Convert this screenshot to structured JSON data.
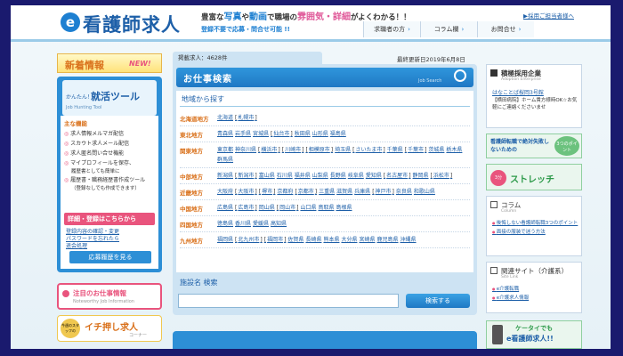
{
  "header": {
    "logo_mark": "e",
    "logo_text": "看護師求人",
    "tagline_pre": "豊富な",
    "tagline_hl1": "写真",
    "tagline_mid": "や",
    "tagline_hl2": "動画",
    "tagline_mid2": "で職場の",
    "tagline_hl3": "雰囲気・詳細",
    "tagline_post": "がよくわかる！！",
    "sub_tag": "登録不要で応募・問合せ可能 !!",
    "recruit_link": "▶採用ご担当者様へ",
    "nav": [
      "求職者の方",
      "コラム欄",
      "お問合せ"
    ]
  },
  "left": {
    "new_banner_t1": "新着情報",
    "new_banner_t2": "NEW!",
    "tool_small": "かんたん！",
    "tool_big": "就活ツール",
    "tool_en": "Job Hunting Tool",
    "main_func": "主な機能",
    "functions": [
      "求人情報メルマガ配信",
      "スカウト求人メール配信",
      "求人匿名問い合せ機能",
      "マイプロフィールを保存、"
    ],
    "functions_sub": [
      "履歴書としても簡単に"
    ],
    "functions2": [
      "履歴書・職務経歴書作成ツール"
    ],
    "functions2_sub": [
      "（登録なしでも作成できます）"
    ],
    "reg_btn": "詳細・登録はこちらから",
    "reg_links": [
      "登録内容の確認・変更",
      "パスワードを忘れたら",
      "退会処理"
    ],
    "apply_btn": "応募履歴を見る",
    "attention_t1": "注目のお仕事情報",
    "attention_t2": "Noteworthy Job Information",
    "ichioshi_circle": "今週のスタッフの",
    "ichioshi_t1": "イチ押し求人",
    "ichioshi_t2": "コーナー"
  },
  "center": {
    "count_label": "掲載求人：4628件",
    "update_label": "最終更新日2019年6月8日",
    "search_head": "お仕事検索",
    "search_en": "Job Search",
    "region_title": "地域から探す",
    "regions": [
      {
        "name": "北海道地方",
        "prefs": [
          {
            "t": "北海道",
            "p": false
          },
          {
            "t": "札幌市",
            "p": true
          }
        ]
      },
      {
        "name": "東北地方",
        "prefs": [
          {
            "t": "青森県",
            "p": false
          },
          {
            "t": "岩手県",
            "p": false
          },
          {
            "t": "宮城県",
            "p": false
          },
          {
            "t": "仙台市",
            "p": true
          },
          {
            "t": "秋田県",
            "p": false
          },
          {
            "t": "山形県",
            "p": false
          },
          {
            "t": "福島県",
            "p": false
          }
        ]
      },
      {
        "name": "関東地方",
        "prefs": [
          {
            "t": "東京都",
            "p": false
          },
          {
            "t": "神奈川県",
            "p": false
          },
          {
            "t": "横浜市",
            "p": true
          },
          {
            "t": "川崎市",
            "p": true
          },
          {
            "t": "相模原市",
            "p": true
          },
          {
            "t": "埼玉県",
            "p": false
          },
          {
            "t": "さいたま市",
            "p": true
          },
          {
            "t": "千葉県",
            "p": false
          },
          {
            "t": "千葉市",
            "p": true
          },
          {
            "t": "茨城県",
            "p": false
          },
          {
            "t": "栃木県",
            "p": false
          },
          {
            "t": "群馬県",
            "p": false
          }
        ]
      },
      {
        "name": "中部地方",
        "prefs": [
          {
            "t": "新潟県",
            "p": false
          },
          {
            "t": "新潟市",
            "p": true
          },
          {
            "t": "富山県",
            "p": false
          },
          {
            "t": "石川県",
            "p": false
          },
          {
            "t": "福井県",
            "p": false
          },
          {
            "t": "山梨県",
            "p": false
          },
          {
            "t": "長野県",
            "p": false
          },
          {
            "t": "岐阜県",
            "p": false
          },
          {
            "t": "愛知県",
            "p": false
          },
          {
            "t": "名古屋市",
            "p": true
          },
          {
            "t": "静岡県",
            "p": false
          },
          {
            "t": "浜松市",
            "p": true
          }
        ]
      },
      {
        "name": "近畿地方",
        "prefs": [
          {
            "t": "大阪府",
            "p": false
          },
          {
            "t": "大阪市",
            "p": true
          },
          {
            "t": "堺市",
            "p": true
          },
          {
            "t": "京都府",
            "p": false
          },
          {
            "t": "京都市",
            "p": true
          },
          {
            "t": "三重県",
            "p": false
          },
          {
            "t": "滋賀県",
            "p": false
          },
          {
            "t": "兵庫県",
            "p": false
          },
          {
            "t": "神戸市",
            "p": true
          },
          {
            "t": "奈良県",
            "p": false
          },
          {
            "t": "和歌山県",
            "p": false
          }
        ]
      },
      {
        "name": "中国地方",
        "prefs": [
          {
            "t": "広島県",
            "p": false
          },
          {
            "t": "広島市",
            "p": true
          },
          {
            "t": "岡山県",
            "p": false
          },
          {
            "t": "岡山市",
            "p": true
          },
          {
            "t": "山口県",
            "p": false
          },
          {
            "t": "鳥取県",
            "p": false
          },
          {
            "t": "島根県",
            "p": false
          }
        ]
      },
      {
        "name": "四国地方",
        "prefs": [
          {
            "t": "徳島県",
            "p": false
          },
          {
            "t": "香川県",
            "p": false
          },
          {
            "t": "愛媛県",
            "p": false
          },
          {
            "t": "高知県",
            "p": false
          }
        ]
      },
      {
        "name": "九州地方",
        "prefs": [
          {
            "t": "福岡県",
            "p": false
          },
          {
            "t": "北九州市",
            "p": true
          },
          {
            "t": "福岡市",
            "p": true
          },
          {
            "t": "佐賀県",
            "p": false
          },
          {
            "t": "長崎県",
            "p": false
          },
          {
            "t": "熊本県",
            "p": false
          },
          {
            "t": "大分県",
            "p": false
          },
          {
            "t": "宮崎県",
            "p": false
          },
          {
            "t": "鹿児島県",
            "p": false
          },
          {
            "t": "沖縄県",
            "p": false
          }
        ]
      }
    ],
    "facility_title": "施設名 検索",
    "facility_placeholder": "",
    "search_btn": "検索する"
  },
  "right": {
    "adopt_title": "積極採用企業",
    "adopt_en": "Adoption Enterprise",
    "adopt_link": "はなことば桜岡3号館",
    "adopt_desc": "【横田病院】ホーム貴方様時OK☆お気軽にご連絡くださいませ",
    "career_text": "看護師転職で絶対失敗しないための",
    "career_circle": "3つのポイント",
    "stretch_num": "3分",
    "stretch_text": "ストレッチ",
    "column_title": "コラム",
    "column_en": "Column",
    "column_links": [
      "後悔しない看護師転職3つのポイント",
      "面接の服装で迷う方法"
    ],
    "related_title": "関連サイト（介護系）",
    "related_en": "Site Link",
    "related_links": [
      "e介護転職",
      "e介護求人情報"
    ],
    "mobile_t1": "ケータイでも",
    "mobile_t2": "e看護師求人!!"
  }
}
